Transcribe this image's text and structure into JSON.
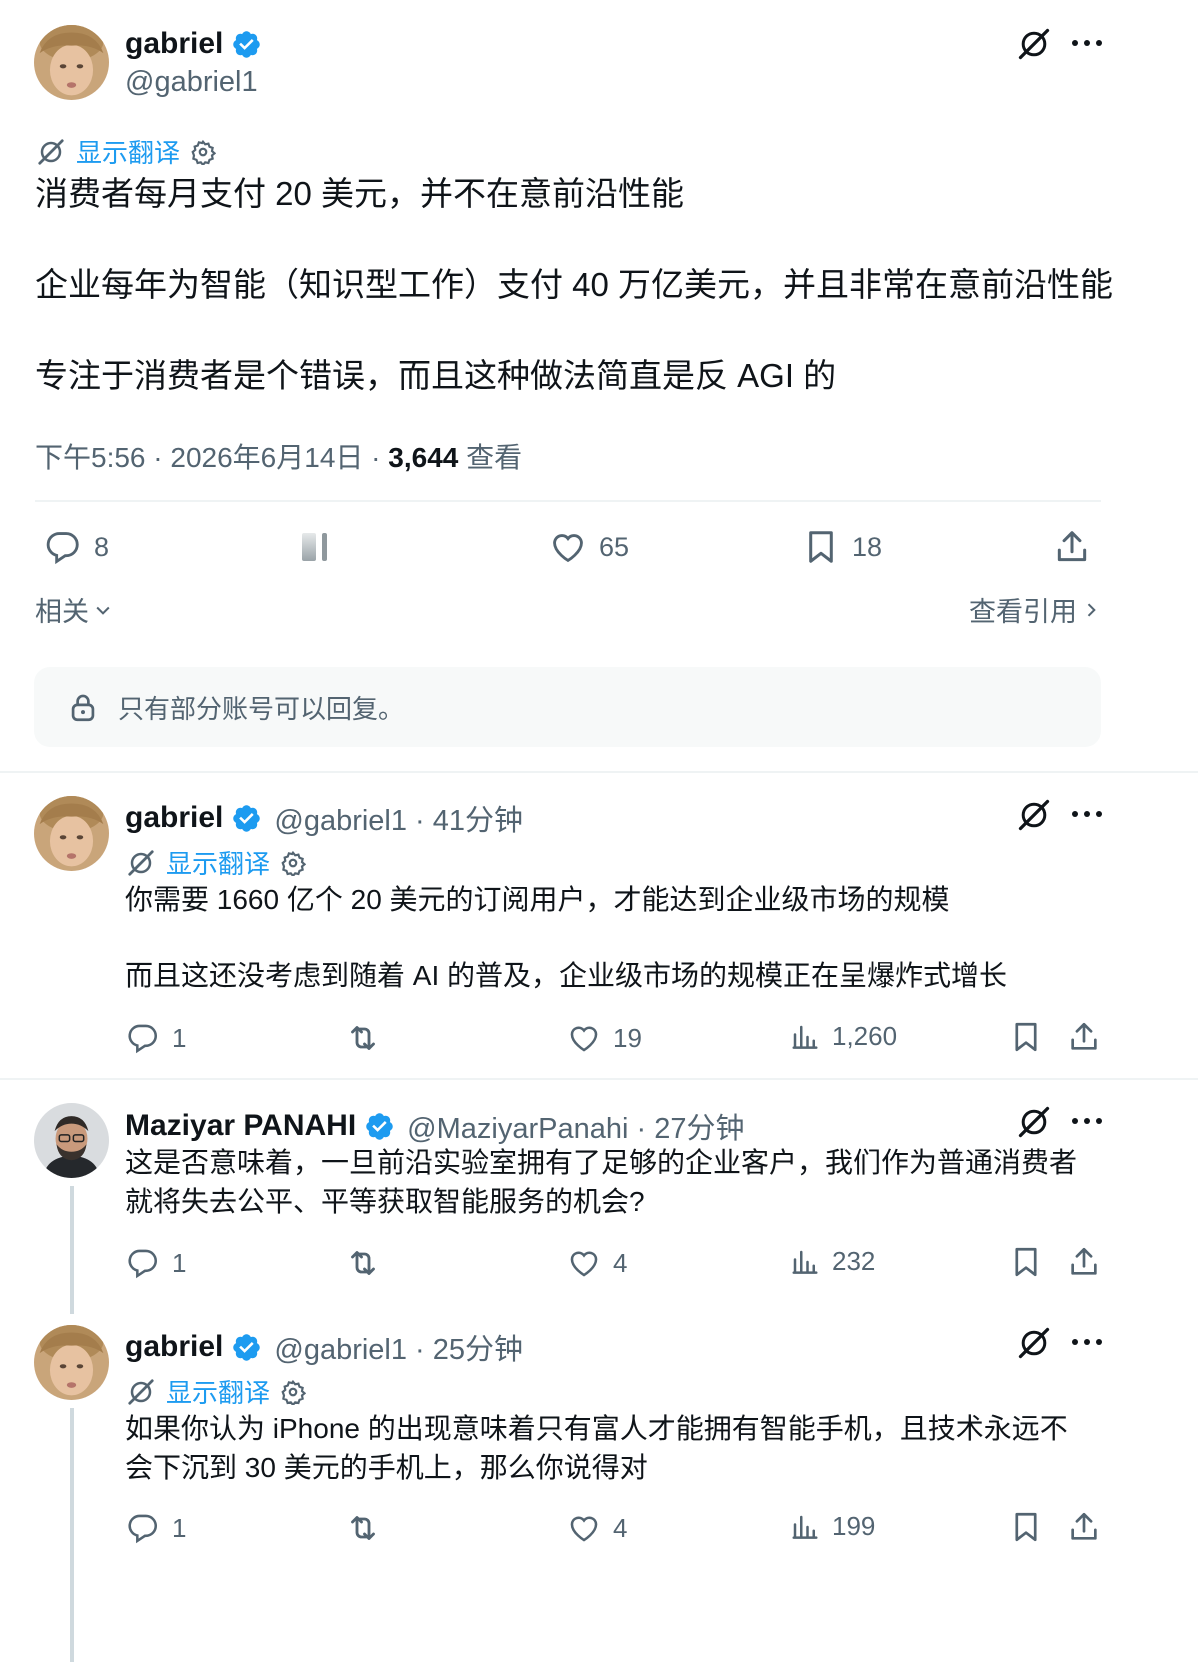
{
  "main_post": {
    "author_name": "gabriel",
    "author_handle": "@gabriel1",
    "translate_label": "显示翻译",
    "text_lines": [
      "消费者每月支付 20 美元，并不在意前沿性能",
      "企业每年为智能（知识型工作）支付 40 万亿美元，并且非常在意前沿性能",
      "专注于消费者是个错误，而且这种做法简直是反 AGI 的"
    ],
    "time": "下午5:56 · 2026年6月14日 · ",
    "views_count": "3,644",
    "views_label": " 查看",
    "stats": {
      "replies": "8",
      "likes": "65",
      "bookmarks": "18"
    },
    "related_label": "相关",
    "quotes_label": "查看引用"
  },
  "reply_notice": "只有部分账号可以回复。",
  "replies": [
    {
      "author_name": "gabriel",
      "meta": "@gabriel1 · 41分钟",
      "translate_label": "显示翻译",
      "text": "你需要 1660 亿个 20 美元的订阅用户，才能达到企业级市场的规模\n\n而且这还没考虑到随着 AI 的普及，企业级市场的规模正在呈爆炸式增长",
      "replies": "1",
      "likes": "19",
      "views": "1,260"
    },
    {
      "author_name": "Maziyar PANAHI",
      "meta": "@MaziyarPanahi · 27分钟",
      "text": "这是否意味着，一旦前沿实验室拥有了足够的企业客户，我们作为普通消费者\n就将失去公平、平等获取智能服务的机会?",
      "replies": "1",
      "likes": "4",
      "views": "232"
    },
    {
      "author_name": "gabriel",
      "meta": "@gabriel1 · 25分钟",
      "translate_label": "显示翻译",
      "text": "如果你认为 iPhone 的出现意味着只有富人才能拥有智能手机，且技术永远不\n会下沉到 30 美元的手机上，那么你说得对",
      "replies": "1",
      "likes": "4",
      "views": "199"
    }
  ],
  "colors": {
    "accent": "#1d9bf0",
    "muted": "#536471",
    "text": "#0f1419",
    "divider": "#eff3f4"
  }
}
